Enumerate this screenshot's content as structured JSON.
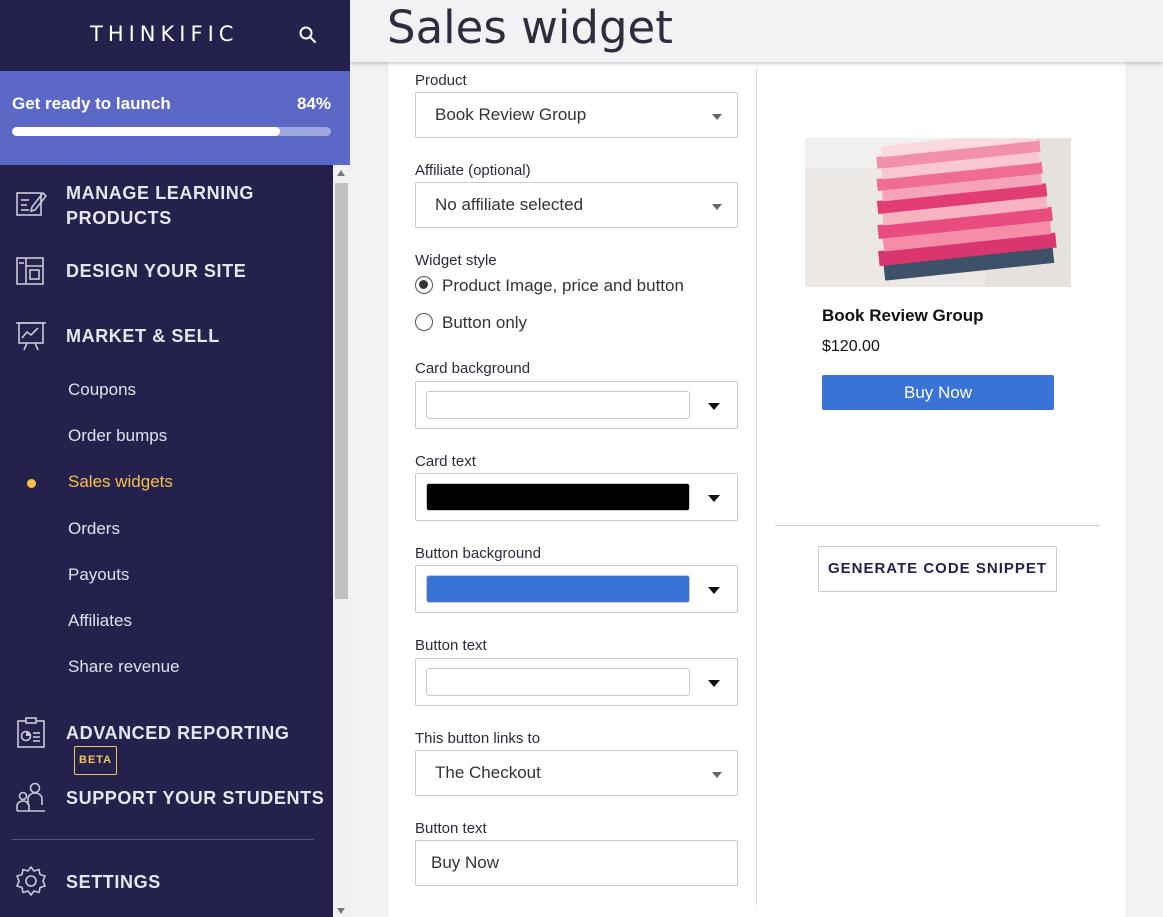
{
  "brand": {
    "logo": "THINKIFIC"
  },
  "launch": {
    "title": "Get ready to launch",
    "percent": "84%",
    "progress": 0.84
  },
  "nav": {
    "sections": [
      {
        "id": "manage",
        "label": "MANAGE LEARNING PRODUCTS",
        "icon": "edit-list-icon"
      },
      {
        "id": "design",
        "label": "DESIGN YOUR SITE",
        "icon": "layout-icon"
      },
      {
        "id": "market",
        "label": "MARKET & SELL",
        "icon": "presentation-chart-icon"
      },
      {
        "id": "reporting",
        "label": "ADVANCED REPORTING",
        "badge": "BETA",
        "icon": "clipboard-chart-icon"
      },
      {
        "id": "support",
        "label": "SUPPORT YOUR STUDENTS",
        "icon": "users-icon"
      },
      {
        "id": "settings",
        "label": "SETTINGS",
        "icon": "gear-icon"
      }
    ],
    "market_items": [
      "Coupons",
      "Order bumps",
      "Sales widgets",
      "Orders",
      "Payouts",
      "Affiliates",
      "Share revenue"
    ],
    "active_item": "Sales widgets"
  },
  "page": {
    "title": "Sales widget"
  },
  "form": {
    "product": {
      "label": "Product",
      "value": "Book Review Group"
    },
    "affiliate": {
      "label": "Affiliate (optional)",
      "value": "No affiliate selected"
    },
    "widget_style": {
      "label": "Widget style",
      "options": [
        "Product Image, price and button",
        "Button only"
      ],
      "selected": "Product Image, price and button"
    },
    "card_background": {
      "label": "Card background",
      "color": "#ffffff"
    },
    "card_text": {
      "label": "Card text",
      "color": "#000000"
    },
    "button_background": {
      "label": "Button background",
      "color": "#3a73d6"
    },
    "button_text_color": {
      "label": "Button text",
      "color": "#ffffff"
    },
    "button_link": {
      "label": "This button links to",
      "value": "The Checkout"
    },
    "button_text": {
      "label": "Button text",
      "value": "Buy Now"
    }
  },
  "preview": {
    "product_name": "Book Review Group",
    "price": "$120.00",
    "button_label": "Buy Now",
    "image": "stack-of-pink-books"
  },
  "actions": {
    "generate_label": "GENERATE CODE SNIPPET"
  }
}
